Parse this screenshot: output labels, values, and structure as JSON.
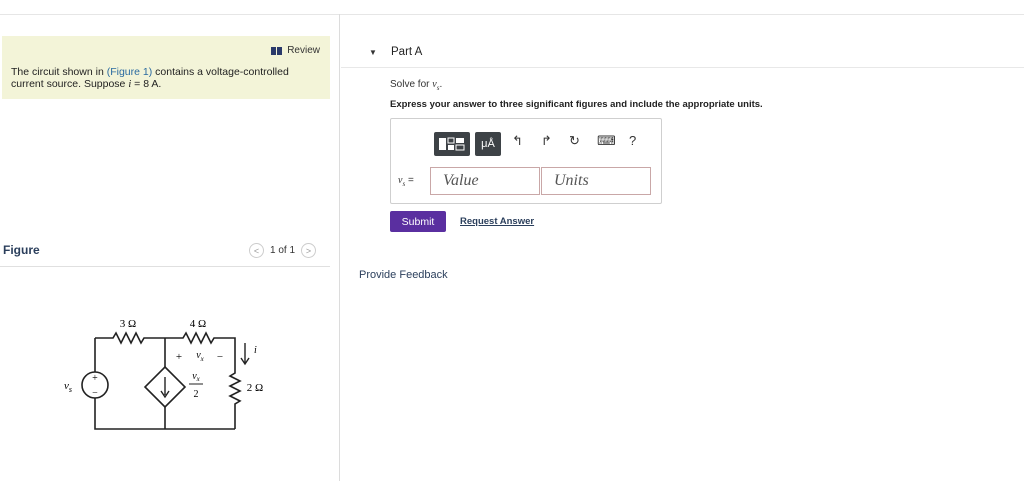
{
  "review": {
    "label": "Review"
  },
  "problem": {
    "text_before": "The circuit shown in ",
    "figure_link": "(Figure 1)",
    "text_after": " contains a voltage-controlled current source. Suppose ",
    "var": "i",
    "value": " = 8 A."
  },
  "figure": {
    "title": "Figure",
    "pager": "1 of 1",
    "prev": "<",
    "next": ">",
    "circuit": {
      "r1": "3 Ω",
      "r2": "4 Ω",
      "r3": "2 Ω",
      "source_label": "v",
      "source_sub": "s",
      "vx_plus": "+",
      "vx_label": "v",
      "vx_sub": "x",
      "vx_minus": "−",
      "ctrl_num_label": "v",
      "ctrl_num_sub": "x",
      "ctrl_den": "2",
      "current_label": "i",
      "src_plus": "+",
      "src_minus": "−"
    }
  },
  "part": {
    "title": "Part A",
    "solve_prefix": "Solve for ",
    "solve_var": "v",
    "solve_sub": "s",
    "solve_suffix": ".",
    "instruction": "Express your answer to three significant figures and include the appropriate units.",
    "toolbar": {
      "mu_label": "μÅ",
      "undo": "↰",
      "redo": "↱",
      "reset": "↻",
      "keyboard": "⌨",
      "help": "?"
    },
    "answer_label": "v",
    "answer_sub": "s",
    "answer_eq": " =",
    "value_placeholder": "Value",
    "units_placeholder": "Units",
    "submit": "Submit",
    "request": "Request Answer"
  },
  "feedback": "Provide Feedback",
  "colors": {
    "submit": "#5a2fa0",
    "problem_bg": "#f3f4d8",
    "toolbar": "#3d4246"
  }
}
